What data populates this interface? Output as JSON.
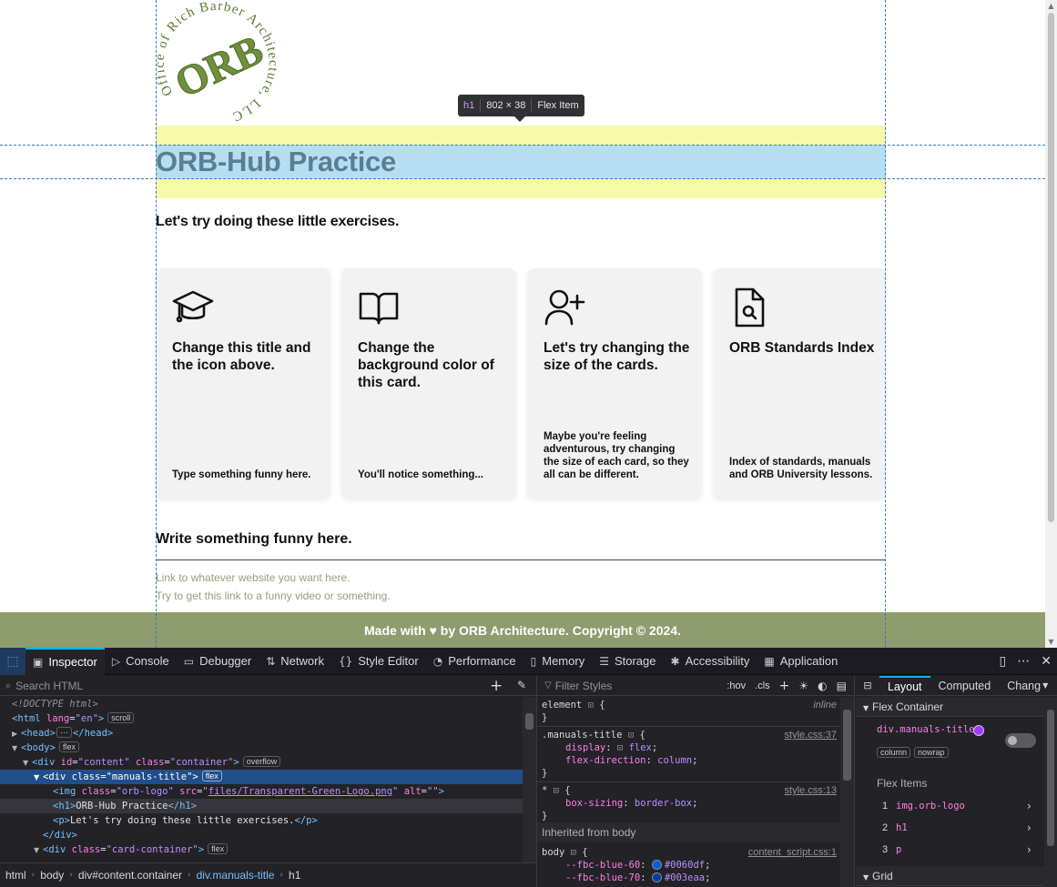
{
  "page": {
    "logo_text": "Office of Rich Barber Architecture, LLC",
    "logo_monogram": "ORB",
    "title": "ORB-Hub Practice",
    "intro": "Let's try doing these little exercises.",
    "cards": [
      {
        "icon": "graduation-cap-icon",
        "title": "Change this title and the icon above.",
        "desc": "Type something funny here."
      },
      {
        "icon": "open-book-icon",
        "title": "Change the background color of this card.",
        "desc": "You'll notice something..."
      },
      {
        "icon": "add-user-icon",
        "title": "Let's try changing the size of the cards.",
        "desc": "Maybe you're feeling adventurous, try changing the size of each card, so they all can be different."
      },
      {
        "icon": "file-search-icon",
        "title": "ORB Standards Index",
        "desc": "Index of standards, manuals and ORB University lessons."
      }
    ],
    "write_heading": "Write something funny here.",
    "links": [
      "Link to whatever website you want here.",
      "Try to get this link to a funny video or something."
    ],
    "footer": "Made with ♥ by ORB Architecture. Copyright © 2024.",
    "colors": {
      "title": "#5c7e93",
      "footer_bg": "#8f9c6e",
      "link": "#93a37a",
      "card_bg": "#f2f2f2"
    }
  },
  "highlight_tooltip": {
    "tag": "h1",
    "size": "802 × 38",
    "type": "Flex Item"
  },
  "devtools": {
    "tabs": [
      {
        "label": "Inspector",
        "icon": "inspector-icon"
      },
      {
        "label": "Console",
        "icon": "console-icon"
      },
      {
        "label": "Debugger",
        "icon": "debugger-icon"
      },
      {
        "label": "Network",
        "icon": "network-icon"
      },
      {
        "label": "Style Editor",
        "icon": "style-editor-icon"
      },
      {
        "label": "Performance",
        "icon": "performance-icon"
      },
      {
        "label": "Memory",
        "icon": "memory-icon"
      },
      {
        "label": "Storage",
        "icon": "storage-icon"
      },
      {
        "label": "Accessibility",
        "icon": "accessibility-icon"
      },
      {
        "label": "Application",
        "icon": "application-icon"
      }
    ],
    "search_placeholder": "Search HTML",
    "tree": {
      "doctype": "<!DOCTYPE html>",
      "html_tag": "html",
      "html_lang_attr": "lang",
      "html_lang_val": "en",
      "html_badge": "scroll",
      "head_tag": "head",
      "body_tag": "body",
      "body_badge": "flex",
      "content_tag": "div",
      "content_id_val": "content",
      "content_class_val": "container",
      "content_badge": "overflow",
      "manuals_tag": "div",
      "manuals_class_val": "manuals-title",
      "manuals_badge": "flex",
      "img_tag": "img",
      "img_class_val": "orb-logo",
      "img_src_val": "files/Transparent-Green-Logo.png",
      "img_alt_val": "",
      "h1_text": "ORB-Hub Practice",
      "p_text": "Let's try doing these little exercises.",
      "card_class_val": "card-container",
      "card_badge": "flex"
    },
    "breadcrumbs": [
      "html",
      "body",
      "div#content.container",
      "div.manuals-title",
      "h1"
    ],
    "rules": {
      "filter_placeholder": "Filter Styles",
      "hov": ":hov",
      "cls": ".cls",
      "element_selector": "element",
      "element_src": "inline",
      "rule1_selector": ".manuals-title",
      "rule1_src": "style.css:37",
      "rule1_decls": [
        {
          "prop": "display",
          "val": "flex"
        },
        {
          "prop": "flex-direction",
          "val": "column"
        }
      ],
      "rule2_selector": "*",
      "rule2_src": "style.css:13",
      "rule2_decls": [
        {
          "prop": "box-sizing",
          "val": "border-box"
        }
      ],
      "inherited_label": "Inherited from body",
      "rule3_selector": "body",
      "rule3_src": "content_script.css:1",
      "rule3_decls": [
        {
          "prop": "--fbc-blue-60",
          "val": "#0060df",
          "color": "#0060df"
        },
        {
          "prop": "--fbc-blue-70",
          "val": "#003eaa",
          "color": "#003eaa"
        }
      ]
    },
    "layout": {
      "tabs": [
        "Layout",
        "Computed",
        "Chang"
      ],
      "flex_container_label": "Flex Container",
      "container_name": "div.manuals-title",
      "badges": [
        "column",
        "nowrap"
      ],
      "flex_items_label": "Flex Items",
      "items": [
        {
          "num": "1",
          "name": "img.orb-logo"
        },
        {
          "num": "2",
          "name": "h1"
        },
        {
          "num": "3",
          "name": "p"
        }
      ],
      "grid_label": "Grid"
    }
  }
}
